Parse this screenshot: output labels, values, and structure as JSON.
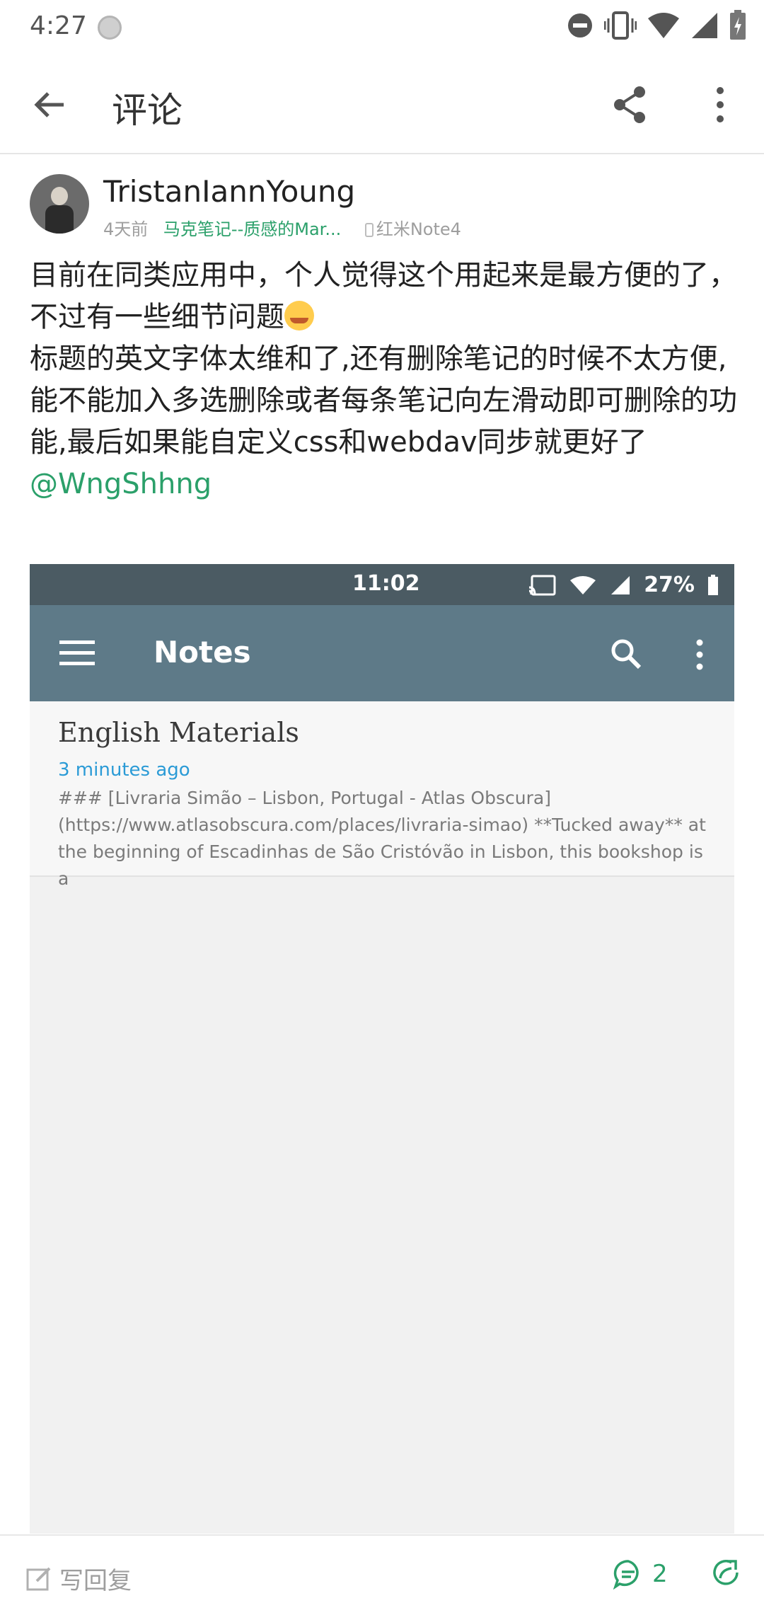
{
  "status_bar": {
    "time": "4:27"
  },
  "app_bar": {
    "title": "评论"
  },
  "post": {
    "username": "TristanIannYoung",
    "time_ago": "4天前",
    "source": "马克笔记--质感的Mar...",
    "device": "红米Note4",
    "content_line1": "目前在同类应用中，个人觉得这个用起来是最方便的了，不过有一些细节问题",
    "content_line2": "标题的英文字体太维和了,还有删除笔记的时候不太方便,能不能加入多选删除或者每条笔记向左滑动即可删除的功能,最后如果能自定义css和webdav同步就更好了",
    "mention": "@WngShhng"
  },
  "screenshot": {
    "status_time": "11:02",
    "battery": "27%",
    "toolbar_title": "Notes",
    "note_title": "English Materials",
    "note_time": "3 minutes ago",
    "note_body": "### [Livraria Simão – Lisbon, Portugal - Atlas Obscura](https://www.atlasobscura.com/places/livraria-simao)  **Tucked away** at the beginning of Escadinhas de São Cristóvão in Lisbon, this bookshop is a"
  },
  "bottom_bar": {
    "reply_placeholder": "写回复",
    "comment_count": "2"
  },
  "colors": {
    "accent_green": "#2ba06a",
    "toolbar_slate": "#5e7a88",
    "link_blue": "#2b9bd6"
  }
}
